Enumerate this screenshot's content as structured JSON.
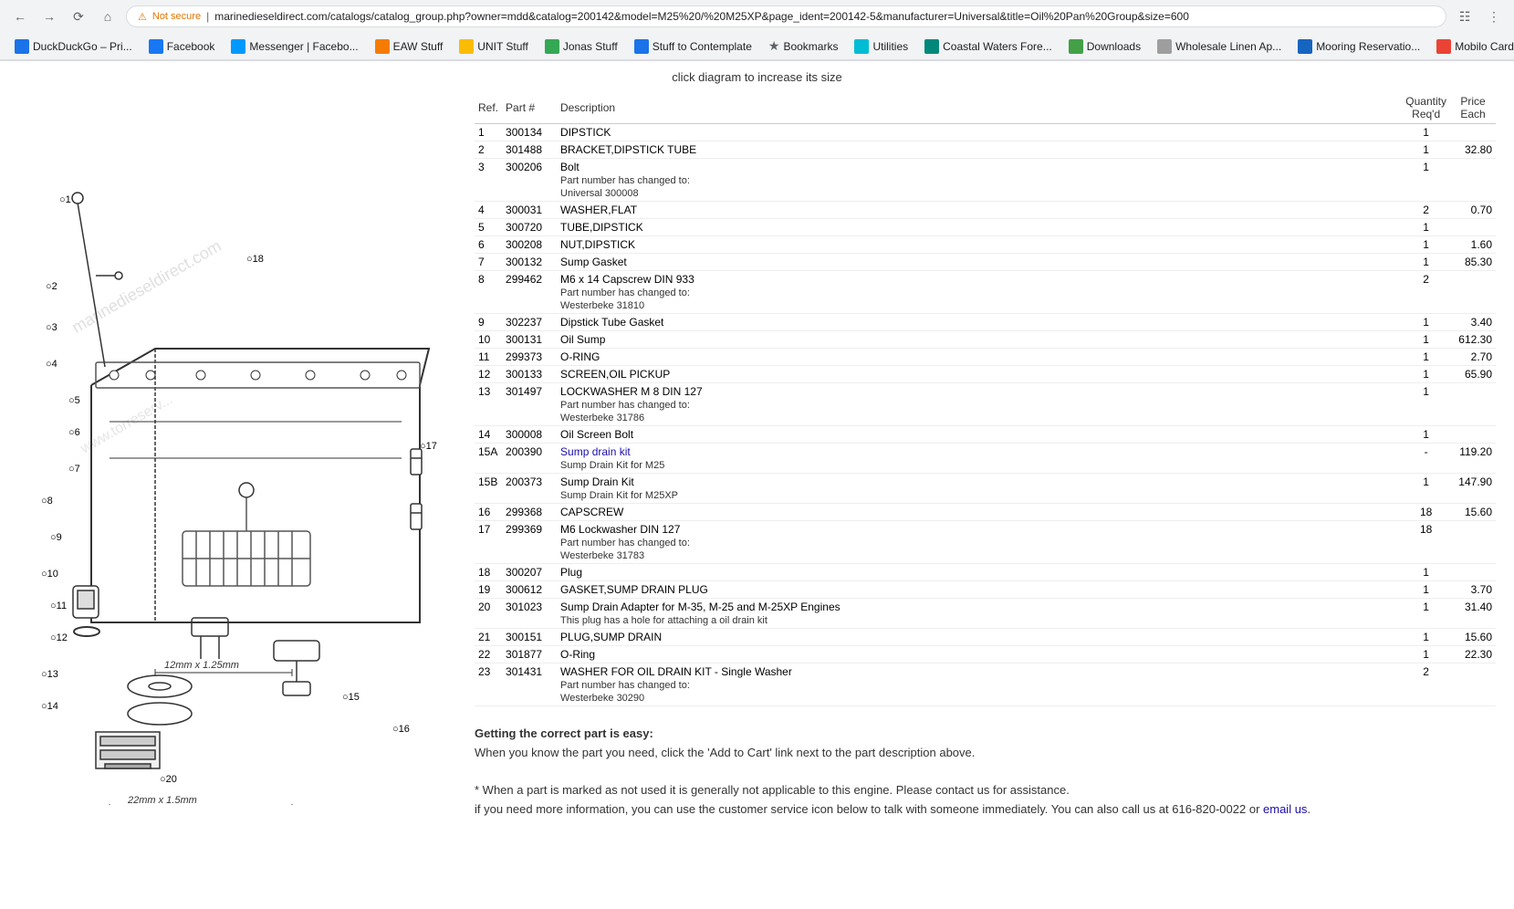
{
  "browser": {
    "url": "marinedieseldirect.com/catalogs/catalog_group.php?owner=mdd&catalog=200142&model=M25%20/%20M25XP&page_ident=200142-5&manufacturer=Universal&title=Oil%20Pan%20Group&size=600",
    "security": "Not secure",
    "nav_back": "←",
    "nav_forward": "→",
    "nav_reload": "↻",
    "nav_home": "⌂"
  },
  "bookmarks": [
    {
      "label": "DuckDuckGo – Pri...",
      "type": "blue"
    },
    {
      "label": "Facebook",
      "type": "fb"
    },
    {
      "label": "Messenger | Facebo...",
      "type": "fb"
    },
    {
      "label": "EAW Stuff",
      "type": "orange"
    },
    {
      "label": "UNIT Stuff",
      "type": "yellow"
    },
    {
      "label": "Jonas Stuff",
      "type": "green"
    },
    {
      "label": "Stuff to Contemplate",
      "type": "blue"
    },
    {
      "label": "Bookmarks",
      "type": "star"
    },
    {
      "label": "Utilities",
      "type": "teal"
    },
    {
      "label": "Coastal Waters Fore...",
      "type": "teal2"
    },
    {
      "label": "Downloads",
      "type": "green2"
    },
    {
      "label": "Wholesale Linen Ap...",
      "type": "gray"
    },
    {
      "label": "Mooring Reservatio...",
      "type": "blue2"
    },
    {
      "label": "Mobilo Card",
      "type": "red"
    }
  ],
  "page": {
    "click_hint": "click diagram to increase its size",
    "table_headers": {
      "ref": "Ref.",
      "part": "Part #",
      "desc": "Description",
      "qty_label1": "Quantity",
      "qty_label2": "Req'd",
      "price_label1": "Price",
      "price_label2": "Each"
    },
    "parts": [
      {
        "ref": "1",
        "part": "300134",
        "desc": "DIPSTICK",
        "sub": "",
        "qty": "1",
        "price": ""
      },
      {
        "ref": "2",
        "part": "301488",
        "desc": "BRACKET,DIPSTICK TUBE",
        "sub": "",
        "qty": "1",
        "price": "32.80"
      },
      {
        "ref": "3",
        "part": "300206",
        "desc": "Bolt",
        "sub": "Part number has changed to:\nUniversal 300008",
        "qty": "1",
        "price": ""
      },
      {
        "ref": "4",
        "part": "300031",
        "desc": "WASHER,FLAT",
        "sub": "",
        "qty": "2",
        "price": "0.70"
      },
      {
        "ref": "5",
        "part": "300720",
        "desc": "TUBE,DIPSTICK",
        "sub": "",
        "qty": "1",
        "price": ""
      },
      {
        "ref": "6",
        "part": "300208",
        "desc": "NUT,DIPSTICK",
        "sub": "",
        "qty": "1",
        "price": "1.60"
      },
      {
        "ref": "7",
        "part": "300132",
        "desc": "Sump Gasket",
        "sub": "",
        "qty": "1",
        "price": "85.30"
      },
      {
        "ref": "8",
        "part": "299462",
        "desc": "M6 x 14 Capscrew DIN 933",
        "sub": "Part number has changed to:\nWesterbeke 31810",
        "qty": "2",
        "price": ""
      },
      {
        "ref": "9",
        "part": "302237",
        "desc": "Dipstick Tube Gasket",
        "sub": "",
        "qty": "1",
        "price": "3.40"
      },
      {
        "ref": "10",
        "part": "300131",
        "desc": "Oil Sump",
        "sub": "",
        "qty": "1",
        "price": "612.30"
      },
      {
        "ref": "11",
        "part": "299373",
        "desc": "O-RING",
        "sub": "",
        "qty": "1",
        "price": "2.70"
      },
      {
        "ref": "12",
        "part": "300133",
        "desc": "SCREEN,OIL PICKUP",
        "sub": "",
        "qty": "1",
        "price": "65.90"
      },
      {
        "ref": "13",
        "part": "301497",
        "desc": "LOCKWASHER M 8 DIN 127",
        "sub": "Part number has changed to:\nWesterbeke 31786",
        "qty": "1",
        "price": ""
      },
      {
        "ref": "14",
        "part": "300008",
        "desc": "Oil Screen Bolt",
        "sub": "",
        "qty": "1",
        "price": ""
      },
      {
        "ref": "15A",
        "part": "200390",
        "desc": "Sump drain kit",
        "sub": "Sump Drain Kit for M25",
        "qty": "-",
        "price": "119.20",
        "link": true
      },
      {
        "ref": "15B",
        "part": "200373",
        "desc": "Sump Drain Kit",
        "sub": "Sump Drain Kit for M25XP",
        "qty": "1",
        "price": "147.90"
      },
      {
        "ref": "16",
        "part": "299368",
        "desc": "CAPSCREW",
        "sub": "",
        "qty": "18",
        "price": "15.60"
      },
      {
        "ref": "17",
        "part": "299369",
        "desc": "M6 Lockwasher DIN 127",
        "sub": "Part number has changed to:\nWesterbeke 31783",
        "qty": "18",
        "price": ""
      },
      {
        "ref": "18",
        "part": "300207",
        "desc": "Plug",
        "sub": "",
        "qty": "1",
        "price": ""
      },
      {
        "ref": "19",
        "part": "300612",
        "desc": "GASKET,SUMP DRAIN PLUG",
        "sub": "",
        "qty": "1",
        "price": "3.70"
      },
      {
        "ref": "20",
        "part": "301023",
        "desc": "Sump Drain Adapter for M-35, M-25 and M-25XP Engines",
        "sub": "This plug has a hole for attaching a oil drain kit",
        "qty": "1",
        "price": "31.40"
      },
      {
        "ref": "21",
        "part": "300151",
        "desc": "PLUG,SUMP DRAIN",
        "sub": "",
        "qty": "1",
        "price": "15.60"
      },
      {
        "ref": "22",
        "part": "301877",
        "desc": "O-Ring",
        "sub": "",
        "qty": "1",
        "price": "22.30"
      },
      {
        "ref": "23",
        "part": "301431",
        "desc": "WASHER FOR OIL DRAIN KIT - Single Washer",
        "sub": "Part number has changed to:\nWesterbeke 30290",
        "qty": "2",
        "price": ""
      }
    ],
    "footer": {
      "title": "Getting the correct part is easy:",
      "line1": "When you know the part you need, click the 'Add to Cart' link next to the part description above.",
      "line2": "* When a part is marked as not used it is generally not applicable to this engine. Please contact us for assistance.",
      "line3": "if you need more information, you can use the customer service icon below to talk with someone immediately. You can also call us at 616-820-0022 or email us."
    }
  }
}
